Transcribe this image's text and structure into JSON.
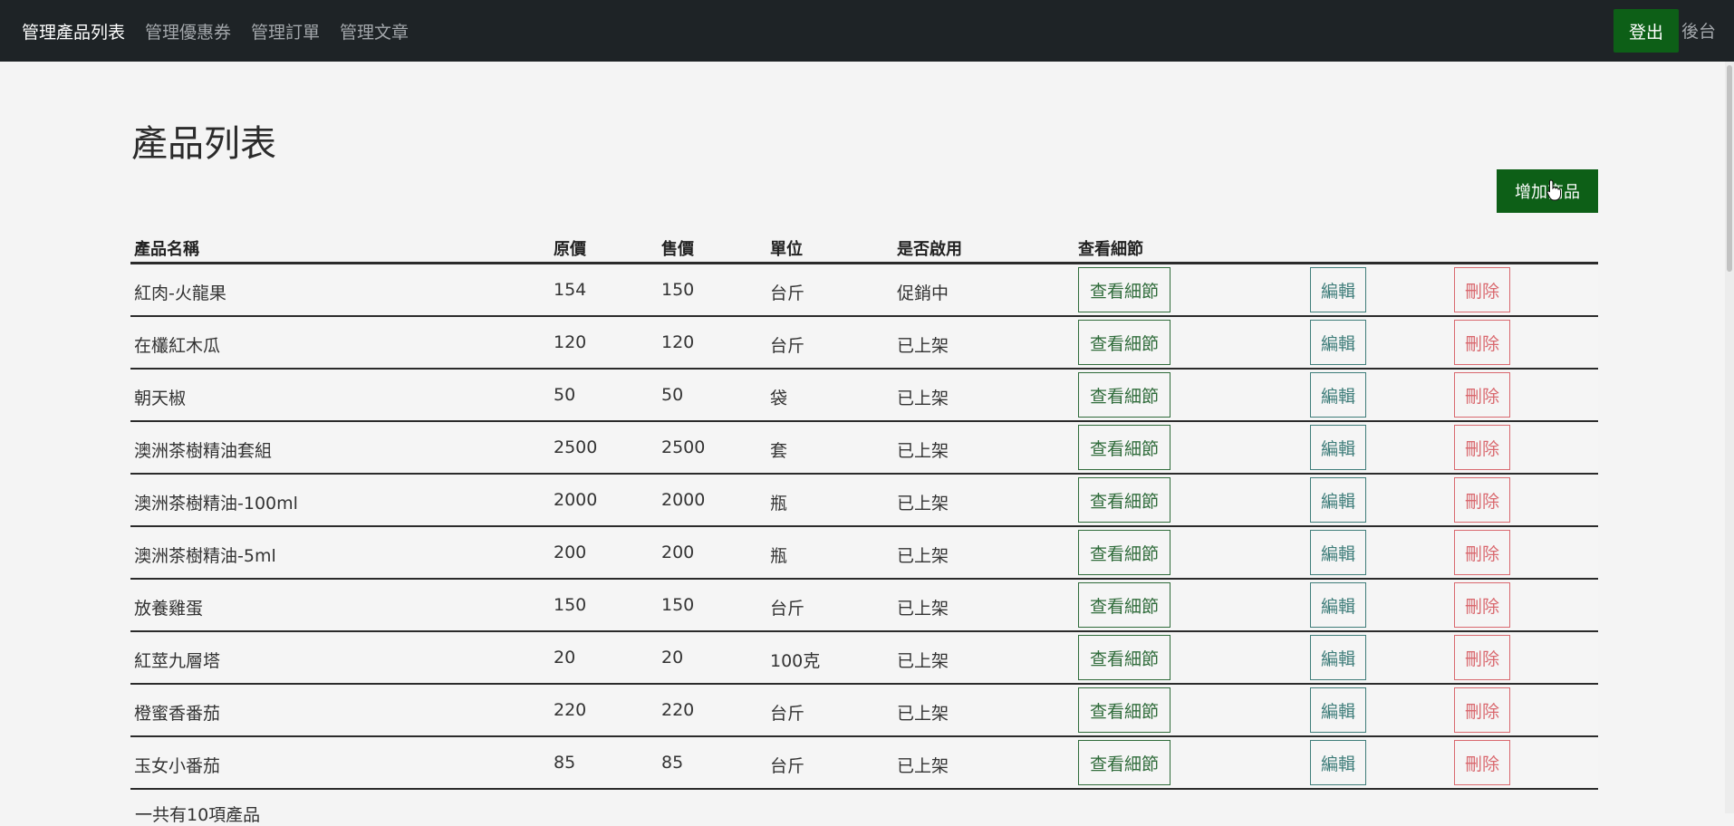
{
  "nav": {
    "links": [
      "管理產品列表",
      "管理優惠券",
      "管理訂單",
      "管理文章"
    ],
    "logout_label": "登出",
    "backstage_label": "後台"
  },
  "page": {
    "title": "產品列表",
    "add_button_label": "增加商品",
    "count_text": "一共有10項產品"
  },
  "table": {
    "headers": [
      "產品名稱",
      "原價",
      "售價",
      "單位",
      "是否啟用",
      "查看細節"
    ],
    "rows": [
      {
        "name": "紅肉-火龍果",
        "original_price": "154",
        "price": "150",
        "unit": "台斤",
        "status": "促銷中"
      },
      {
        "name": "在欉紅木瓜",
        "original_price": "120",
        "price": "120",
        "unit": "台斤",
        "status": "已上架"
      },
      {
        "name": "朝天椒",
        "original_price": "50",
        "price": "50",
        "unit": "袋",
        "status": "已上架"
      },
      {
        "name": "澳洲茶樹精油套組",
        "original_price": "2500",
        "price": "2500",
        "unit": "套",
        "status": "已上架"
      },
      {
        "name": "澳洲茶樹精油-100ml",
        "original_price": "2000",
        "price": "2000",
        "unit": "瓶",
        "status": "已上架"
      },
      {
        "name": "澳洲茶樹精油-5ml",
        "original_price": "200",
        "price": "200",
        "unit": "瓶",
        "status": "已上架"
      },
      {
        "name": "放養雞蛋",
        "original_price": "150",
        "price": "150",
        "unit": "台斤",
        "status": "已上架"
      },
      {
        "name": "紅莖九層塔",
        "original_price": "20",
        "price": "20",
        "unit": "100克",
        "status": "已上架"
      },
      {
        "name": "橙蜜香番茄",
        "original_price": "220",
        "price": "220",
        "unit": "台斤",
        "status": "已上架"
      },
      {
        "name": "玉女小番茄",
        "original_price": "85",
        "price": "85",
        "unit": "台斤",
        "status": "已上架"
      }
    ],
    "detail_label": "查看細節",
    "edit_label": "編輯",
    "delete_label": "刪除"
  },
  "colors": {
    "navbar_bg": "#1e2326",
    "primary_green": "#0d5f17",
    "detail_outline": "#2f6b3a",
    "edit_outline": "#3f7d7a",
    "delete_outline": "#d9686e"
  }
}
